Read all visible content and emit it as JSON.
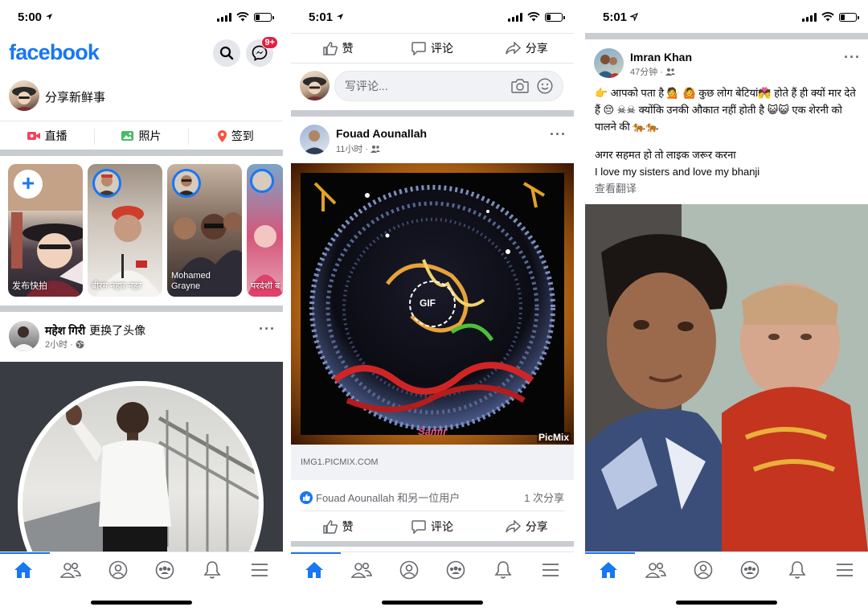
{
  "screens": [
    {
      "status_time": "5:00",
      "brand": "facebook",
      "messenger_badge": "9+",
      "composer_prompt": "分享新鲜事",
      "actions": [
        "直播",
        "照片",
        "签到"
      ],
      "stories": [
        {
          "label": "发布快拍"
        },
        {
          "label": "बीरम नहार नहर"
        },
        {
          "label": "Mohamed Grayne"
        },
        {
          "label": "परदेशी बा"
        }
      ],
      "post": {
        "author": "महेश गिरी",
        "action": "更换了头像",
        "time": "2小时 · "
      }
    },
    {
      "status_time": "5:01",
      "actions": [
        "赞",
        "评论",
        "分享"
      ],
      "comment_placeholder": "写评论...",
      "post": {
        "author": "Fouad Aounallah",
        "time": "11小时 · ",
        "gif_label": "GIF",
        "picmix": "PicMix",
        "samir": "Samir",
        "link_domain": "IMG1.PICMIX.COM",
        "likes": "Fouad Aounallah 和另一位用户",
        "shares": "1 次分享"
      },
      "bottom_actions": [
        "赞",
        "评论",
        "分享"
      ]
    },
    {
      "status_time": "5:01",
      "post": {
        "author": "Imran Khan",
        "time": "47分钟 · ",
        "body_line1": "👉 आपको पता है 💁 🙆  कुछ लोग बेटियां💏   होते हैं  ही क्यों मार देते हैं 😔 ☠☠ क्योंकि उनकी औकात नहीं होती है 😺😺 एक शेरनी को पालने की 🐅🐅",
        "body_line2": "अगर सहमत हो तो लाइक जरूर करना",
        "body_line3": "I love my sisters and love my bhanji",
        "translate": "查看翻译"
      }
    }
  ],
  "tab_icons": [
    "home-icon",
    "friends-icon",
    "profile-icon",
    "groups-icon",
    "notifications-icon",
    "menu-icon"
  ],
  "colors": {
    "brand": "#1877f2",
    "separator": "#c9ccd1",
    "badge": "#e41e3f"
  }
}
